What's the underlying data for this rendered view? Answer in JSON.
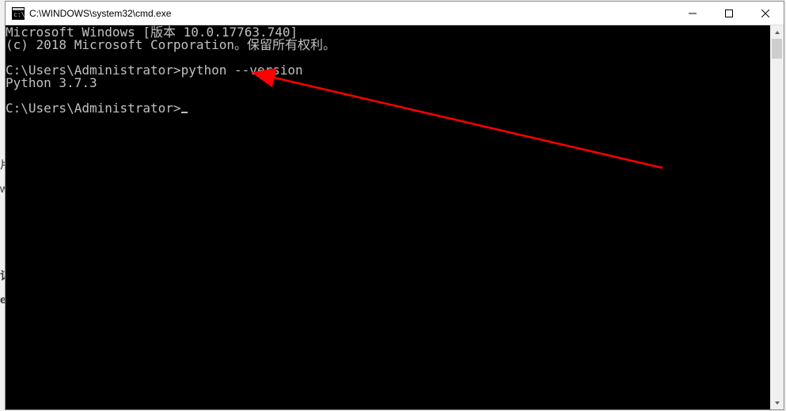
{
  "window": {
    "title": "C:\\WINDOWS\\system32\\cmd.exe"
  },
  "terminal": {
    "line1": "Microsoft Windows [版本 10.0.17763.740]",
    "line2": "(c) 2018 Microsoft Corporation。保留所有权利。",
    "blank1": "",
    "prompt1_prefix": "C:\\Users\\Administrator>",
    "prompt1_cmd": "python --version",
    "output1": "Python 3.7.3",
    "blank2": "",
    "prompt2_prefix": "C:\\Users\\Administrator>"
  },
  "annotation": {
    "arrow_color": "#ff0000"
  }
}
